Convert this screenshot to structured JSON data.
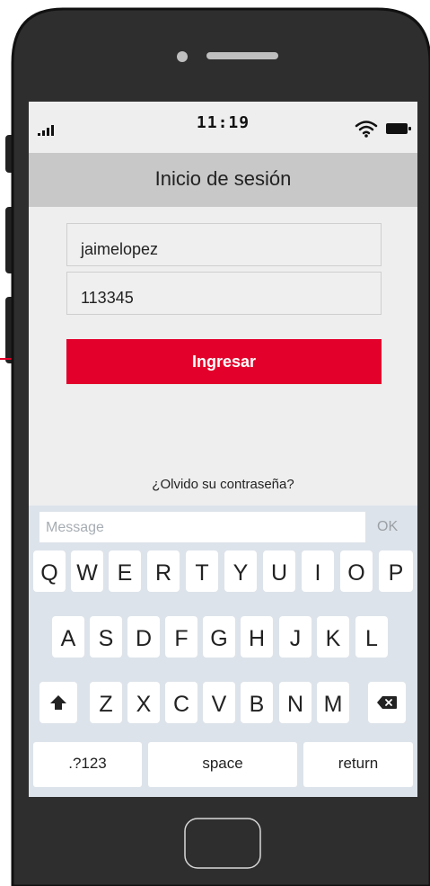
{
  "status_bar": {
    "time": "11:19",
    "signal_icon": "signal-icon",
    "wifi_icon": "wifi-icon",
    "battery_icon": "battery-icon"
  },
  "header": {
    "title": "Inicio de sesión"
  },
  "form": {
    "username_value": "jaimelopez",
    "password_value": "113345",
    "login_label": "Ingresar",
    "forgot_label": "¿Olvido su contraseña?"
  },
  "keyboard": {
    "message_placeholder": "Message",
    "ok_label": "OK",
    "row1": [
      "Q",
      "W",
      "E",
      "R",
      "T",
      "Y",
      "U",
      "I",
      "O",
      "P"
    ],
    "row2": [
      "A",
      "S",
      "D",
      "F",
      "G",
      "H",
      "J",
      "K",
      "L"
    ],
    "row3": [
      "Z",
      "X",
      "C",
      "V",
      "B",
      "N",
      "M"
    ],
    "shift_icon": "shift-icon",
    "backspace_icon": "backspace-icon",
    "numbers_label": ".?123",
    "space_label": "space",
    "return_label": "return"
  },
  "colors": {
    "accent": "#e3002b",
    "phone_body": "#2e2e2e",
    "header_bg": "#c8c8c8",
    "screen_bg": "#eeeeef",
    "keyboard_bg": "#dde3ea"
  }
}
